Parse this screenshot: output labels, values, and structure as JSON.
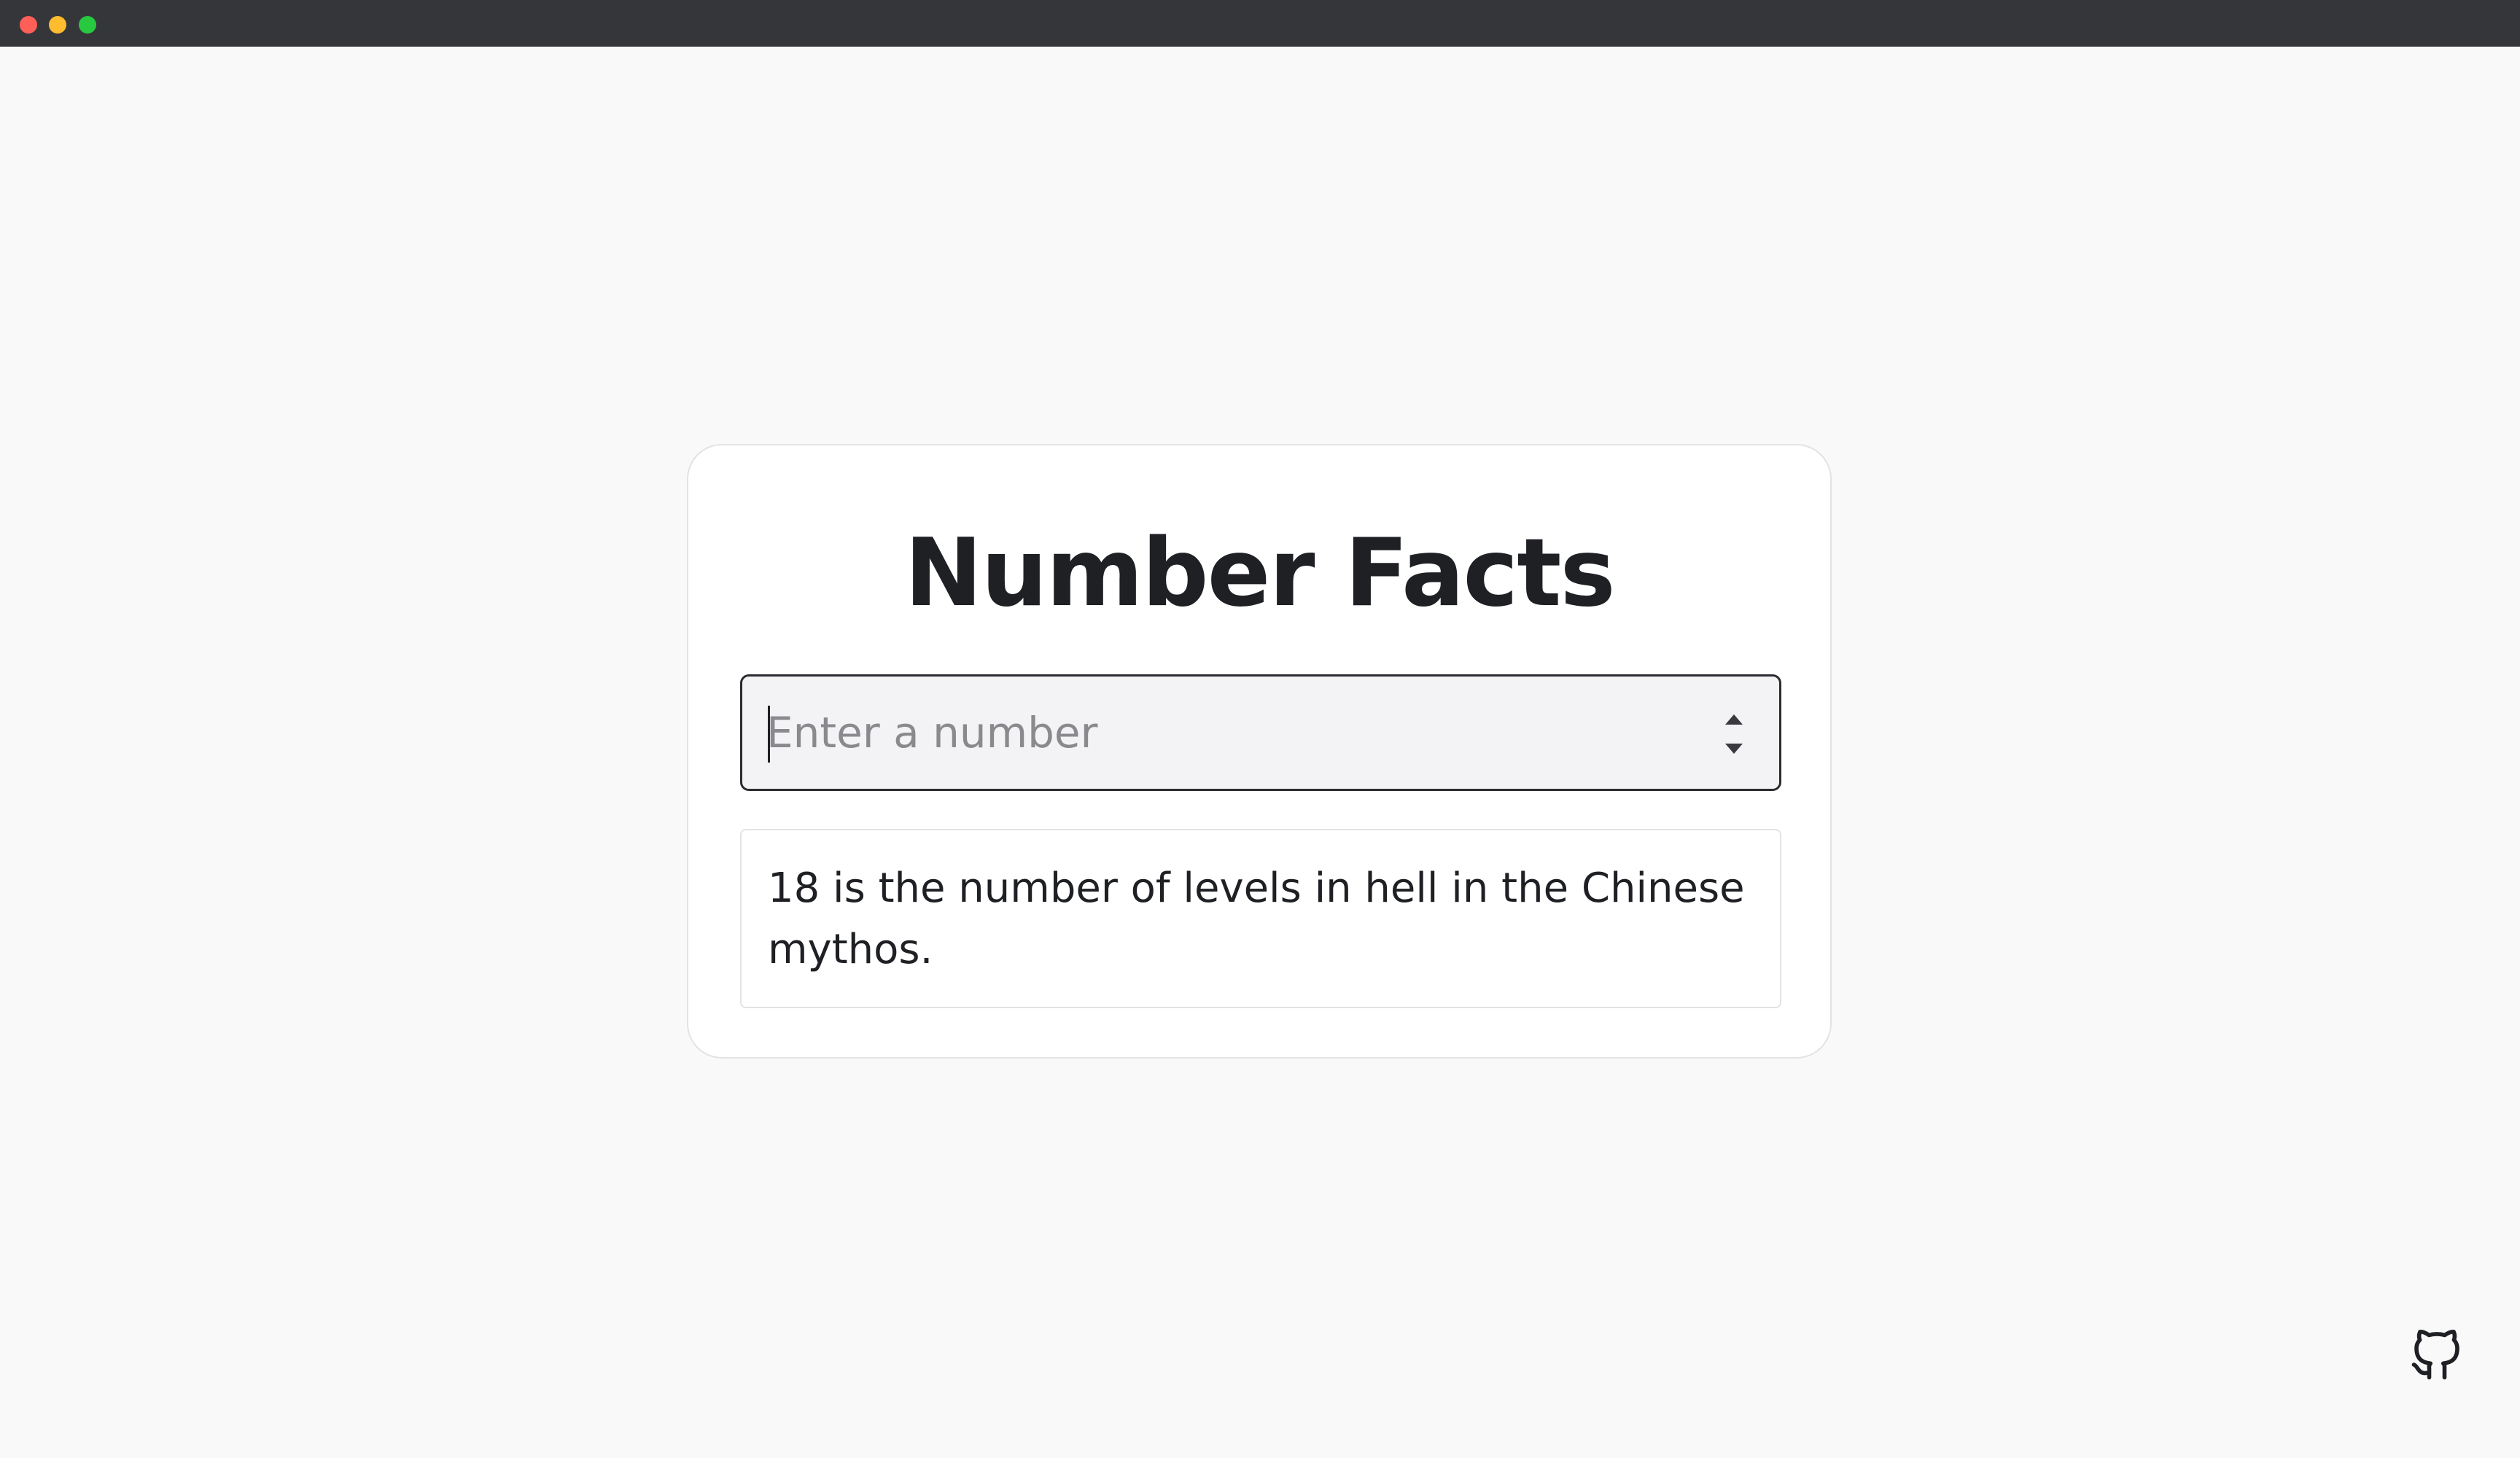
{
  "window": {
    "traffic_lights": {
      "close_color": "#fe5f57",
      "minimize_color": "#febc2e",
      "zoom_color": "#28c840"
    }
  },
  "card": {
    "title": "Number Facts",
    "number_input": {
      "value": "",
      "placeholder": "Enter a number"
    },
    "fact": {
      "text": "18 is the number of levels in hell in the Chinese mythos."
    }
  },
  "footer": {
    "github_icon": "github-icon"
  },
  "colors": {
    "page_background": "#f9f9f9",
    "card_background": "#ffffff",
    "text": "#1e2024",
    "input_background": "#f3f3f5",
    "titlebar": "#35363a"
  }
}
